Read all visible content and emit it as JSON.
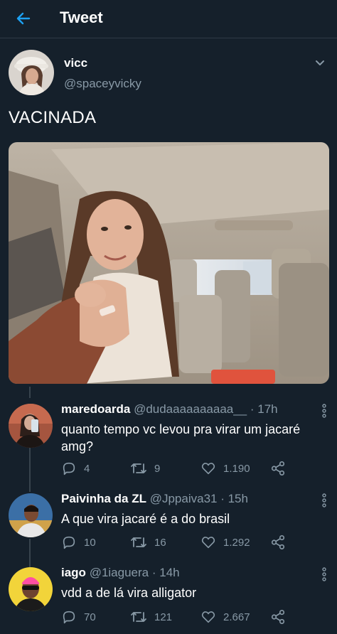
{
  "header": {
    "title": "Tweet"
  },
  "tweet": {
    "author_name": "vicc",
    "author_handle": "@spaceyvicky",
    "text": "VACINADA"
  },
  "replies": [
    {
      "name": "maredoarda",
      "handle": "@dudaaaaaaaaaa__",
      "time": "· 17h",
      "text": "quanto tempo vc levou pra virar um jacaré amg?",
      "comments": "4",
      "retweets": "9",
      "likes": "1.190"
    },
    {
      "name": "Paivinha da ZL",
      "handle": "@Jppaiva31",
      "time": "· 15h",
      "text": "A que vira jacaré é a do brasil",
      "comments": "10",
      "retweets": "16",
      "likes": "1.292"
    },
    {
      "name": "iago",
      "handle": "@1iaguera",
      "time": "· 14h",
      "text": "vdd a de lá vira alligator",
      "comments": "70",
      "retweets": "121",
      "likes": "2.667"
    }
  ],
  "colors": {
    "background": "#15202b",
    "accent": "#1da1f2",
    "muted": "#8899a6",
    "divider": "#38444d"
  },
  "icons": [
    "back-arrow-icon",
    "chevron-down-icon",
    "reply-icon",
    "retweet-icon",
    "like-icon",
    "share-icon",
    "more-icon"
  ]
}
